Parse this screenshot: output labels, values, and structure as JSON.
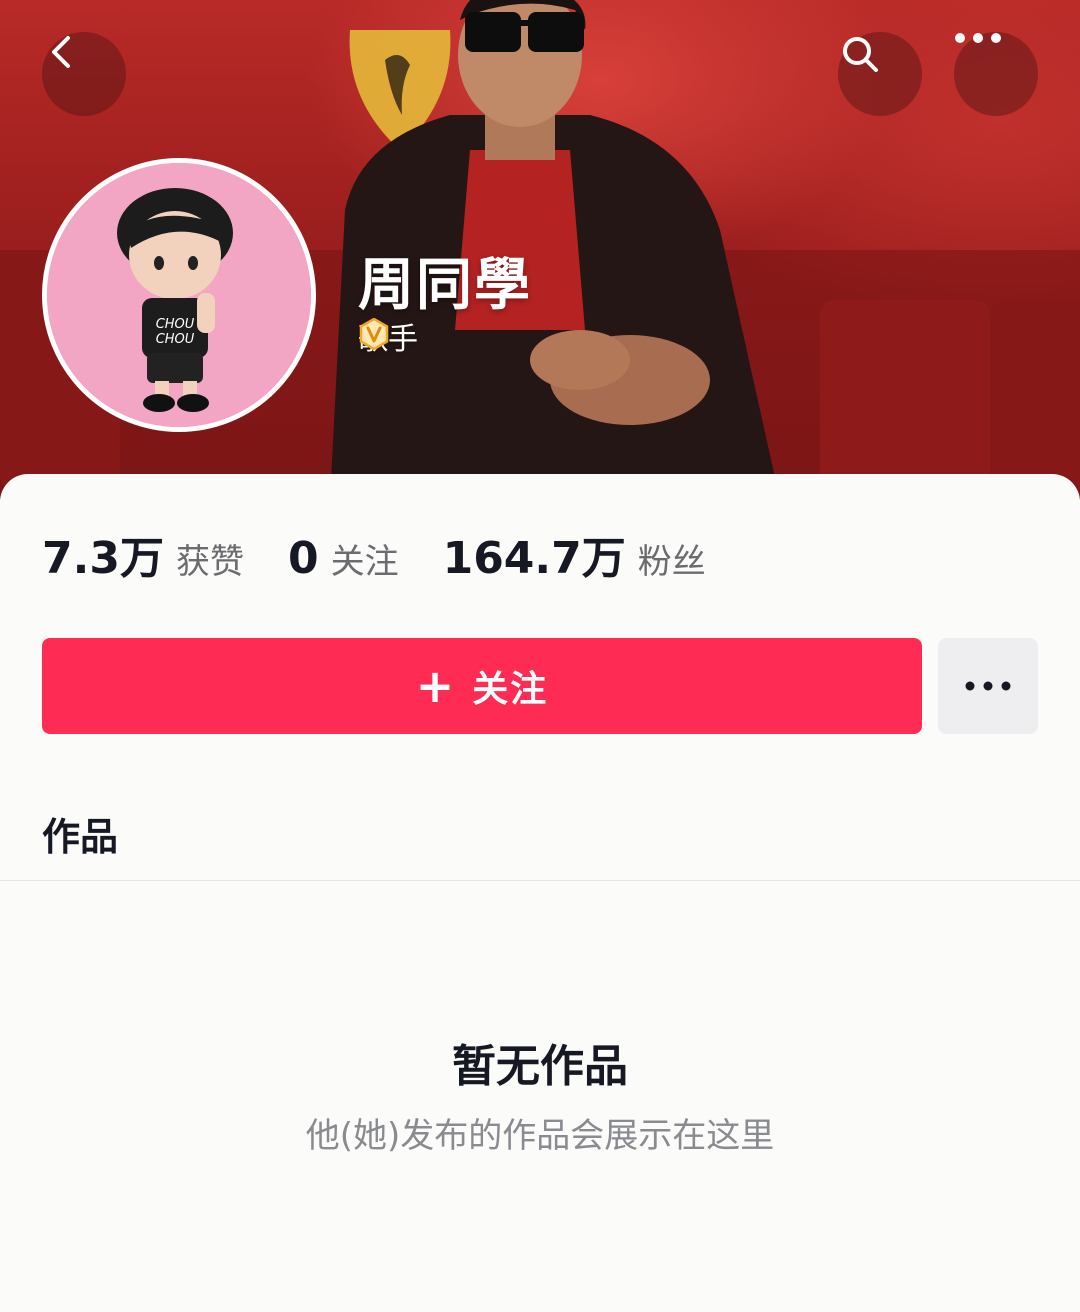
{
  "header": {
    "username": "周同學",
    "verified_title": "歌手"
  },
  "icons": {
    "back": "chevron-left-icon",
    "search": "search-icon",
    "more": "more-horizontal-icon",
    "verified": "verified-v-badge-icon",
    "follow_plus": "plus-icon"
  },
  "stats": [
    {
      "number": "7.3万",
      "label": "获赞"
    },
    {
      "number": "0",
      "label": "关注"
    },
    {
      "number": "164.7万",
      "label": "粉丝"
    }
  ],
  "actions": {
    "follow_plus": "+",
    "follow_label": "关注"
  },
  "tabs": {
    "works": "作品"
  },
  "empty_state": {
    "title": "暂无作品",
    "subtitle": "他(她)发布的作品会展示在这里"
  },
  "colors": {
    "accent": "#fe2c55",
    "badge_gold": "#f5a623",
    "text_primary": "#161823",
    "text_secondary": "#8a8b91"
  }
}
